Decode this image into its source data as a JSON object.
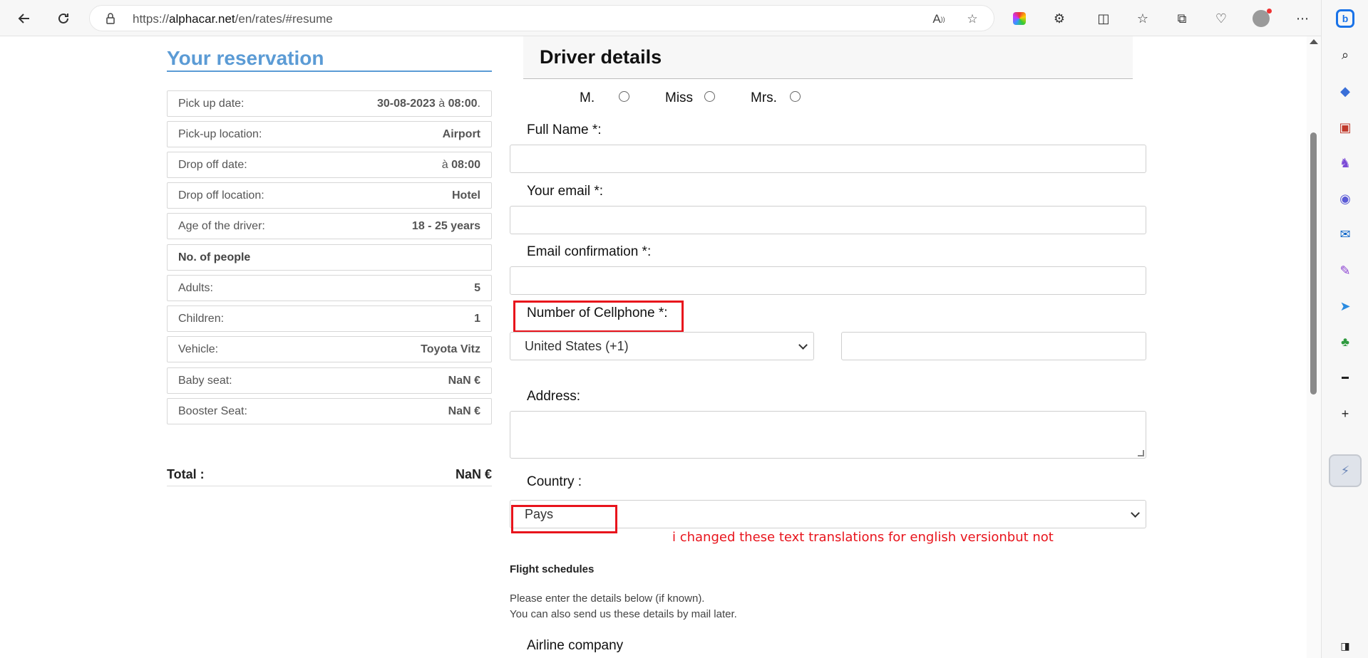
{
  "browser": {
    "url_prefix": "https://",
    "url_host": "alphacar.net",
    "url_path": "/en/rates/#resume"
  },
  "reservation": {
    "title": "Your reservation",
    "rows": [
      {
        "label": "Pick up date:",
        "value_bold": "30-08-2023",
        "value_mid": " à ",
        "value_bold2": "08:00",
        "value_end": "."
      },
      {
        "label": "Pick-up location:",
        "value_bold": "Airport"
      },
      {
        "label": "Drop off date:",
        "value_mid": "à ",
        "value_bold2": "08:00"
      },
      {
        "label": "Drop off location:",
        "value_bold": "Hotel"
      },
      {
        "label": "Age of the driver:",
        "value_bold": "18 - 25 years"
      },
      {
        "label": "No. of people"
      },
      {
        "label": "Adults:",
        "value_bold": "5"
      },
      {
        "label": "Children:",
        "value_bold": "1"
      },
      {
        "label": "Vehicle:",
        "value_bold": "Toyota Vitz"
      },
      {
        "label": "Baby seat:",
        "value_bold": "NaN €"
      },
      {
        "label": "Booster Seat:",
        "value_bold": "NaN €"
      }
    ],
    "total_label": "Total :",
    "total_value": "NaN €"
  },
  "form": {
    "title": "Driver details",
    "titles": [
      "M.",
      "Miss",
      "Mrs."
    ],
    "full_name_label": "Full Name *:",
    "email_label": "Your email *:",
    "email_confirm_label": "Email confirmation *:",
    "cellphone_label": "Number of Cellphone *:",
    "country_code_selected": "United States (+1)",
    "address_label": "Address:",
    "country_label": "Country :",
    "country_selected": "Pays",
    "annotation": "i changed these text translations for english versionbut not visibl",
    "flight_title": "Flight schedules",
    "flight_text1": "Please enter the details below (if known).",
    "flight_text2": "You can also send us these details by mail later.",
    "airline_label": "Airline company"
  },
  "colors": {
    "accent_blue": "#5b9bd5",
    "annotation_red": "#e8141c"
  }
}
